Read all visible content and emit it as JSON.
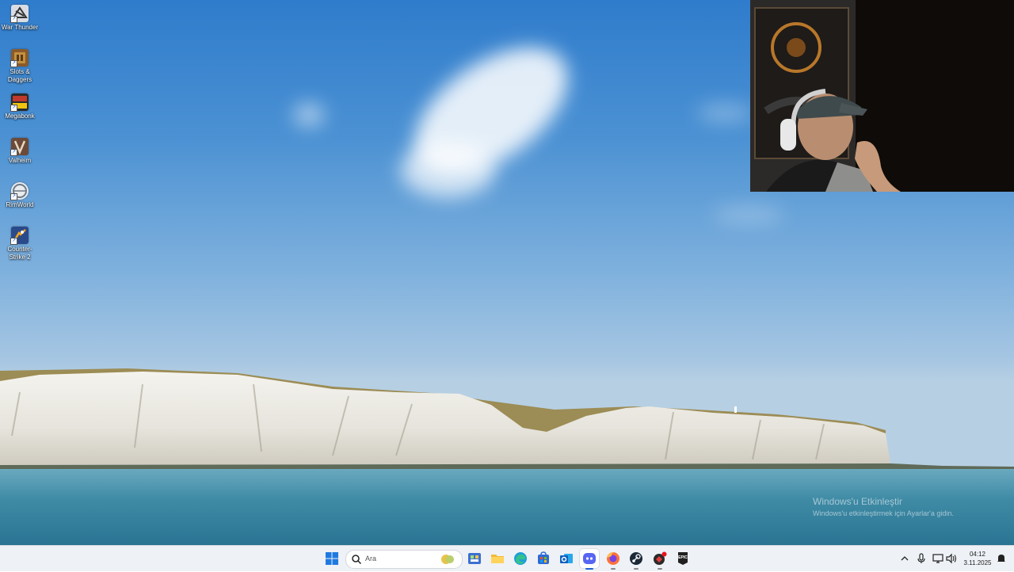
{
  "desktop": {
    "icons": [
      {
        "label": "War Thunder",
        "icon": "war-thunder-icon",
        "color": "#d9dde3"
      },
      {
        "label": "Slots & Daggers",
        "icon": "slots-daggers-icon",
        "color": "#8a5a2b"
      },
      {
        "label": "Megabonk",
        "icon": "megabonk-icon",
        "color": "#c0392b"
      },
      {
        "label": "Valheim",
        "icon": "valheim-icon",
        "color": "#6b4a3a"
      },
      {
        "label": "RimWorld",
        "icon": "rimworld-icon",
        "color": "#e8ecef"
      },
      {
        "label": "Counter-Strike 2",
        "icon": "counter-strike-2-icon",
        "color": "#2b4a8a"
      }
    ]
  },
  "watermark": {
    "title": "Windows'u Etkinleştir",
    "subtitle": "Windows'u etkinleştirmek için Ayarlar'a gidin."
  },
  "taskbar": {
    "search_placeholder": "Ara",
    "apps": [
      {
        "icon": "start-icon"
      },
      {
        "icon": "search-icon"
      },
      {
        "icon": "widgets-icon"
      },
      {
        "icon": "file-explorer-icon"
      },
      {
        "icon": "edge-icon"
      },
      {
        "icon": "store-icon"
      },
      {
        "icon": "outlook-icon"
      },
      {
        "icon": "discord-icon"
      },
      {
        "icon": "firefox-icon"
      },
      {
        "icon": "steam-icon"
      },
      {
        "icon": "app-icon"
      },
      {
        "icon": "epic-games-icon"
      }
    ],
    "epic_label": "EPIC",
    "time": "04:12",
    "date": "3.11.2025"
  },
  "colors": {
    "accent": "#1f5fd6",
    "discord": "#5865f2",
    "steam": "#1b2838"
  }
}
